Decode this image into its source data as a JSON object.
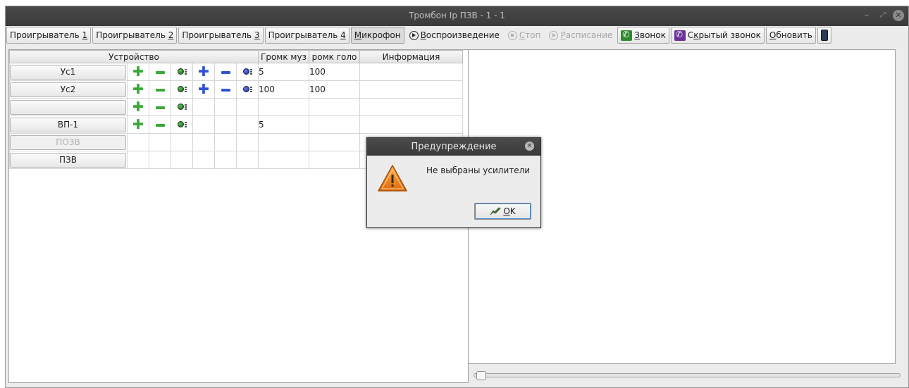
{
  "window": {
    "title": "Тромбон Ip ПЗВ - 1 - 1",
    "controls": {
      "minimize": "–",
      "restore": "⤢",
      "close": "✕"
    }
  },
  "toolbar": {
    "player1": {
      "prefix": "Проигрыватель ",
      "key": "1"
    },
    "player2": {
      "prefix": "Проигрыватель ",
      "key": "2"
    },
    "player3": {
      "prefix": "Проигрыватель ",
      "key": "3"
    },
    "player4": {
      "prefix": "Проигрыватель ",
      "key": "4"
    },
    "microphone": {
      "key": "М",
      "rest": "икрофон"
    },
    "playback": {
      "key": "В",
      "rest": "оспроизведение",
      "icon": "play-circle-icon"
    },
    "stop": {
      "key": "С",
      "rest": "топ",
      "icon": "stop-circle-icon"
    },
    "schedule": {
      "key": "Р",
      "rest": "асписание",
      "icon": "play-circle-icon"
    },
    "call": {
      "key": "З",
      "rest": "вонок",
      "icon": "phone-green-icon"
    },
    "hidden_call": {
      "pre": "С",
      "key": "к",
      "rest": "рытый звонок",
      "icon": "phone-purple-icon"
    },
    "refresh": {
      "key": "О",
      "rest": "бновить"
    },
    "device_icon": "device-icon"
  },
  "table": {
    "headers": {
      "device": "Устройство",
      "music_volume": "Громк муз",
      "voice_volume": "ромк голо",
      "info": "Информация"
    },
    "rows": [
      {
        "device": "Ус1",
        "enabled": true,
        "icons": [
          "green-plus",
          "green-minus",
          "green-volume",
          "blue-plus",
          "blue-minus",
          "blue-volume"
        ],
        "music": "5",
        "voice": "100",
        "info": ""
      },
      {
        "device": "Ус2",
        "enabled": true,
        "icons": [
          "green-plus",
          "green-minus",
          "green-volume",
          "blue-plus",
          "blue-minus",
          "blue-volume"
        ],
        "music": "100",
        "voice": "100",
        "info": ""
      },
      {
        "device": "",
        "enabled": true,
        "icons": [
          "green-plus",
          "green-minus",
          "green-volume"
        ],
        "music": "",
        "voice": "",
        "info": ""
      },
      {
        "device": "ВП-1",
        "enabled": true,
        "icons": [
          "green-plus",
          "green-minus",
          "green-volume"
        ],
        "music": "5",
        "voice": "",
        "info": ""
      },
      {
        "device": "ПОЗВ",
        "enabled": false,
        "icons": [],
        "music": "",
        "voice": "",
        "info": ""
      },
      {
        "device": "ПЗВ",
        "enabled": true,
        "icons": [],
        "music": "",
        "voice": "",
        "info": ""
      }
    ]
  },
  "dialog": {
    "title": "Предупреждение",
    "message": "Не выбраны усилители",
    "ok": {
      "key": "O",
      "rest": "K"
    },
    "icon": "warning-triangle-icon"
  },
  "slider": {
    "value": 0
  },
  "colors": {
    "titlebar": "#3e3e3e",
    "green": "#3aa83a",
    "blue": "#2f55d0",
    "warning": "#f08a1c"
  }
}
